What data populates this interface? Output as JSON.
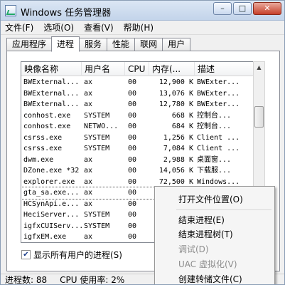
{
  "window": {
    "title": "Windows 任务管理器",
    "btn_min": "–",
    "btn_max": "□",
    "btn_close": "✕"
  },
  "menubar": [
    "文件(F)",
    "选项(O)",
    "查看(V)",
    "帮助(H)"
  ],
  "tabs": [
    "应用程序",
    "进程",
    "服务",
    "性能",
    "联网",
    "用户"
  ],
  "active_tab": "进程",
  "columns": [
    "映像名称",
    "用户名",
    "CPU",
    "内存(...",
    "描述"
  ],
  "rows": [
    [
      "BWExternal...",
      "ax",
      "00",
      "12,900 K",
      "BWExter..."
    ],
    [
      "BWExternal...",
      "ax",
      "00",
      "13,076 K",
      "BWExter..."
    ],
    [
      "BWExternal...",
      "ax",
      "00",
      "12,780 K",
      "BWExter..."
    ],
    [
      "conhost.exe",
      "SYSTEM",
      "00",
      "668 K",
      "控制台..."
    ],
    [
      "conhost.exe",
      "NETWO...",
      "00",
      "684 K",
      "控制台..."
    ],
    [
      "csrss.exe",
      "SYSTEM",
      "00",
      "1,256 K",
      "Client ..."
    ],
    [
      "csrss.exe",
      "SYSTEM",
      "00",
      "7,084 K",
      "Client ..."
    ],
    [
      "dwm.exe",
      "ax",
      "00",
      "2,988 K",
      "桌面窗..."
    ],
    [
      "DZone.exe *32",
      "ax",
      "00",
      "14,056 K",
      "下载服..."
    ],
    [
      "explorer.exe",
      "ax",
      "00",
      "72,500 K",
      "Windows..."
    ],
    [
      "gta_sa.exe...",
      "ax",
      "00",
      "",
      ""
    ],
    [
      "HCSynApi.e...",
      "ax",
      "00",
      "",
      ""
    ],
    [
      "HeciServer...",
      "SYSTEM",
      "00",
      "",
      ""
    ],
    [
      "igfxCUIServ...",
      "SYSTEM",
      "00",
      "",
      ""
    ],
    [
      "igfxEM.exe",
      "ax",
      "00",
      "",
      ""
    ]
  ],
  "checkbox": {
    "label": "显示所有用户的进程(S)",
    "checked": "✔"
  },
  "statusbar": {
    "processes": "进程数: 88",
    "cpu": "CPU 使用率: 2%"
  },
  "context_menu": [
    {
      "label": "打开文件位置(O)",
      "enabled": true
    },
    {
      "label": "结束进程(E)",
      "enabled": true
    },
    {
      "label": "结束进程树(T)",
      "enabled": true
    },
    {
      "label": "调试(D)",
      "enabled": false
    },
    {
      "label": "UAC 虚拟化(V)",
      "enabled": false
    },
    {
      "label": "创建转储文件(C)",
      "enabled": true
    }
  ],
  "scrollbar": {
    "up": "▲",
    "down": "▼"
  }
}
